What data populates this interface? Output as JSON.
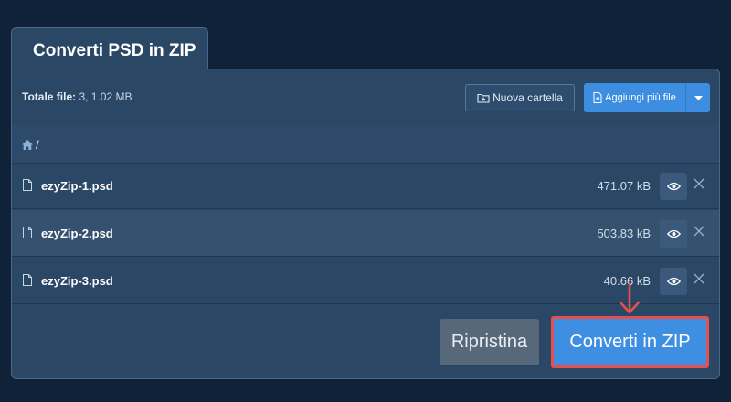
{
  "tab": {
    "title": "Converti PSD in ZIP"
  },
  "toolbar": {
    "total_label": "Totale file:",
    "total_value": " 3, 1.02 MB",
    "new_folder_label": "Nuova cartella",
    "add_files_label": "Aggiungi più file"
  },
  "breadcrumb": {
    "separator": "/"
  },
  "files": [
    {
      "name": "ezyZip-1.psd",
      "size": "471.07 kB"
    },
    {
      "name": "ezyZip-2.psd",
      "size": "503.83 kB"
    },
    {
      "name": "ezyZip-3.psd",
      "size": "40.66 kB"
    }
  ],
  "actions": {
    "reset_label": "Ripristina",
    "convert_label": "Converti in ZIP"
  },
  "colors": {
    "background": "#0f2237",
    "panel": "#2b4766",
    "primary": "#3e8fe2",
    "highlight": "#e4504f"
  }
}
